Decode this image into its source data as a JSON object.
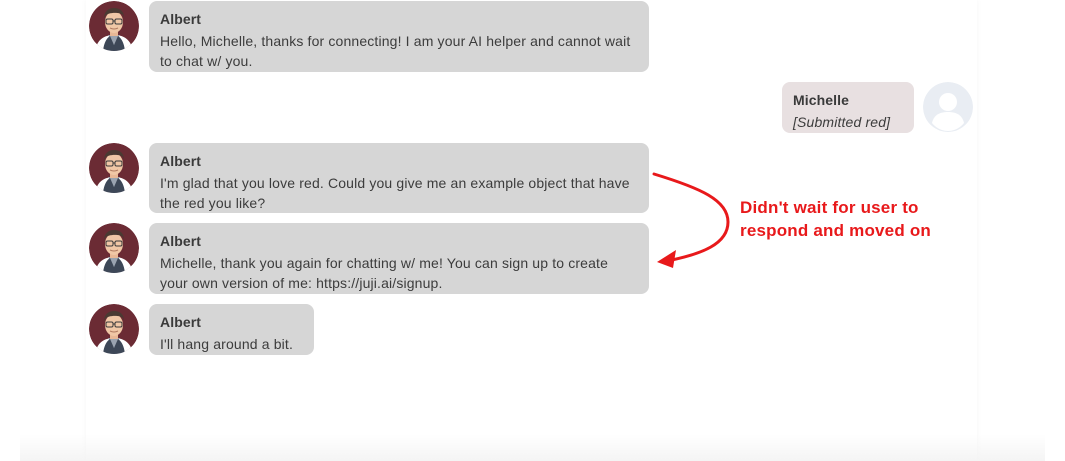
{
  "messages": [
    {
      "sender": "Albert",
      "text": "Hello, Michelle, thanks for connecting! I am your AI helper and cannot wait to chat w/ you."
    },
    {
      "sender": "Michelle",
      "text": "[Submitted red]"
    },
    {
      "sender": "Albert",
      "text": "I'm glad that you love red. Could you give me an example object that have the red you like?"
    },
    {
      "sender": "Albert",
      "text": "Michelle, thank you again for chatting w/ me! You can sign up to create your own version of me: https://juji.ai/signup."
    },
    {
      "sender": "Albert",
      "text": "I'll hang around a bit."
    }
  ],
  "annotation": {
    "line1": "Didn't wait for user to",
    "line2": "respond and moved on"
  },
  "icons": {
    "bot_avatar": "bot-avatar-icon",
    "user_avatar": "default-user-avatar-icon",
    "arrow": "curved-arrow-icon"
  },
  "colors": {
    "bot_bubble": "#d6d6d6",
    "user_bubble": "#e8e0e1",
    "annotation": "#e8191b",
    "avatar_bg": "#6b2b34",
    "user_avatar_bg": "#e9edf3"
  }
}
